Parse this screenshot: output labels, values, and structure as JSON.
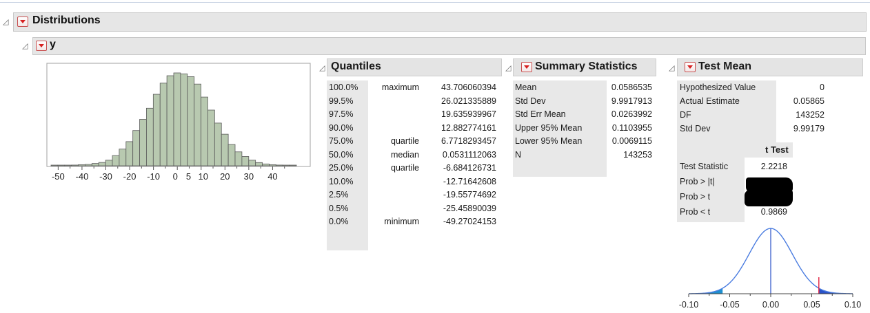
{
  "report": {
    "title": "Distributions",
    "variable": "y"
  },
  "histogram": {
    "axis_ticks": [
      "-50",
      "-40",
      "-30",
      "-20",
      "-10",
      "0",
      "5",
      "10",
      "20",
      "30",
      "40"
    ],
    "bar_color": "#b8c9b0",
    "bar_heights": [
      0.004,
      0.004,
      0.006,
      0.008,
      0.012,
      0.015,
      0.025,
      0.036,
      0.06,
      0.11,
      0.18,
      0.26,
      0.38,
      0.5,
      0.62,
      0.77,
      0.89,
      0.97,
      1.0,
      0.99,
      0.96,
      0.88,
      0.74,
      0.6,
      0.46,
      0.34,
      0.23,
      0.15,
      0.1,
      0.06,
      0.035,
      0.02,
      0.012,
      0.008,
      0.005,
      0.004
    ]
  },
  "quantiles": {
    "title": "Quantiles",
    "rows": [
      {
        "pct": "100.0%",
        "label": "maximum",
        "value": "43.706060394"
      },
      {
        "pct": "99.5%",
        "label": "",
        "value": "26.021335889"
      },
      {
        "pct": "97.5%",
        "label": "",
        "value": "19.635939967"
      },
      {
        "pct": "90.0%",
        "label": "",
        "value": "12.882774161"
      },
      {
        "pct": "75.0%",
        "label": "quartile",
        "value": "6.7718293457"
      },
      {
        "pct": "50.0%",
        "label": "median",
        "value": "0.0531112063"
      },
      {
        "pct": "25.0%",
        "label": "quartile",
        "value": "-6.684126731"
      },
      {
        "pct": "10.0%",
        "label": "",
        "value": "-12.71642608"
      },
      {
        "pct": "2.5%",
        "label": "",
        "value": "-19.55774692"
      },
      {
        "pct": "0.5%",
        "label": "",
        "value": "-25.45890039"
      },
      {
        "pct": "0.0%",
        "label": "minimum",
        "value": "-49.27024153"
      }
    ]
  },
  "summary": {
    "title": "Summary Statistics",
    "rows": [
      {
        "label": "Mean",
        "value": "0.0586535"
      },
      {
        "label": "Std Dev",
        "value": "9.9917913"
      },
      {
        "label": "Std Err Mean",
        "value": "0.0263992"
      },
      {
        "label": "Upper 95% Mean",
        "value": "0.1103955"
      },
      {
        "label": "Lower 95% Mean",
        "value": "0.0069115"
      },
      {
        "label": "N",
        "value": "143253"
      }
    ]
  },
  "test_mean": {
    "title": "Test Mean",
    "rows": [
      {
        "label": "Hypothesized Value",
        "value": "0"
      },
      {
        "label": "Actual Estimate",
        "value": "0.05865"
      },
      {
        "label": "DF",
        "value": "143252"
      },
      {
        "label": "Std Dev",
        "value": "9.99179"
      }
    ],
    "t_test_header": "t Test",
    "t_rows": [
      {
        "label": "Test Statistic",
        "value": "2.2218"
      },
      {
        "label": "Prob > |t|",
        "value": ""
      },
      {
        "label": "Prob > t",
        "value": ""
      },
      {
        "label": "Prob < t",
        "value": "0.9869"
      }
    ],
    "density_axis_ticks": [
      "-0.10",
      "-0.05",
      "0.00",
      "0.05",
      "0.10"
    ],
    "curve_color": "#4a7ce0",
    "estimate_marker_color": "#e02040"
  }
}
